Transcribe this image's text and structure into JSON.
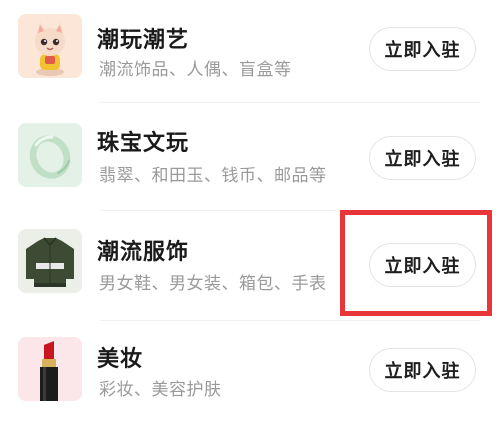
{
  "categories": [
    {
      "title": "潮玩潮艺",
      "description": "潮流饰品、人偶、盲盒等",
      "button_label": "立即入驻",
      "image": "cartoon-figure-icon"
    },
    {
      "title": "珠宝文玩",
      "description": "翡翠、和田玉、钱币、邮品等",
      "button_label": "立即入驻",
      "image": "jade-bangle-icon"
    },
    {
      "title": "潮流服饰",
      "description": "男女鞋、男女装、箱包、手表",
      "button_label": "立即入驻",
      "image": "jacket-icon"
    },
    {
      "title": "美妆",
      "description": "彩妆、美容护肤",
      "button_label": "立即入驻",
      "image": "lipstick-icon"
    }
  ],
  "colors": {
    "highlight": "#e8353a",
    "title_text": "#1a1a1a",
    "description_text": "#9a9a9a",
    "button_border": "#e4e4e4"
  },
  "highlighted_item": "潮流服饰"
}
